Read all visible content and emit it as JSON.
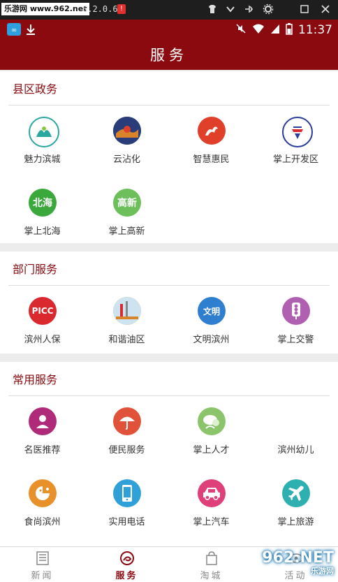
{
  "emulator": {
    "site_badge": "乐游网 www.962.net",
    "title": "6.2.0.6",
    "alert": "!",
    "controls": [
      "shirt-icon",
      "chevron-down-icon",
      "pin-icon",
      "gear-icon",
      "maximize-icon",
      "close-icon"
    ]
  },
  "status_bar": {
    "time": "11:37",
    "icons": [
      "app-icon",
      "download-icon",
      "mute-icon",
      "wifi-icon",
      "signal-icon",
      "battery-icon"
    ]
  },
  "header": {
    "title": "服务"
  },
  "sections": [
    {
      "title": "县区政务",
      "items": [
        {
          "label": "魅力滨城",
          "icon": "mountain-icon",
          "color": "#ffffff"
        },
        {
          "label": "云沾化",
          "icon": "photo-icon",
          "color": "#2a3c7a"
        },
        {
          "label": "智慧惠民",
          "icon": "flame-icon",
          "color": "#e0402a"
        },
        {
          "label": "掌上开发区",
          "icon": "emblem-icon",
          "color": "#ffffff"
        },
        {
          "label": "掌上北海",
          "icon": "text-icon",
          "text": "北海",
          "color": "#3aa83a"
        },
        {
          "label": "掌上高新",
          "icon": "text-icon",
          "text": "高新",
          "color": "#6cbf5a"
        }
      ]
    },
    {
      "title": "部门服务",
      "items": [
        {
          "label": "滨州人保",
          "icon": "text-icon",
          "text": "PICC",
          "color": "#d9282e"
        },
        {
          "label": "和谐油区",
          "icon": "photo-icon",
          "color": "#d9842a"
        },
        {
          "label": "文明滨州",
          "icon": "text-icon",
          "text": "文明",
          "color": "#2f7fd0"
        },
        {
          "label": "掌上交警",
          "icon": "traffic-light-icon",
          "color": "#b060b0"
        }
      ]
    },
    {
      "title": "常用服务",
      "items": [
        {
          "label": "名医推荐",
          "icon": "doctor-icon",
          "color": "#b02a7a"
        },
        {
          "label": "便民服务",
          "icon": "umbrella-icon",
          "color": "#e0533a"
        },
        {
          "label": "掌上人才",
          "icon": "people-icon",
          "color": "#8cc46c"
        },
        {
          "label": "滨州幼儿",
          "icon": "blank-icon",
          "color": "#ffffff"
        },
        {
          "label": "食尚滨州",
          "icon": "food-icon",
          "color": "#e8902a"
        },
        {
          "label": "实用电话",
          "icon": "phone-icon",
          "color": "#2fa0d8"
        },
        {
          "label": "掌上汽车",
          "icon": "car-icon",
          "color": "#e0407a"
        },
        {
          "label": "掌上旅游",
          "icon": "plane-icon",
          "color": "#2fb0b0"
        }
      ]
    }
  ],
  "tabs": [
    {
      "label": "新闻",
      "icon": "news-icon",
      "active": false
    },
    {
      "label": "服务",
      "icon": "service-icon",
      "active": true
    },
    {
      "label": "淘城",
      "icon": "bag-icon",
      "active": false
    },
    {
      "label": "活动",
      "icon": "activity-icon",
      "active": false
    }
  ],
  "watermark": {
    "line1": "962.NET",
    "line2": "乐游网"
  }
}
